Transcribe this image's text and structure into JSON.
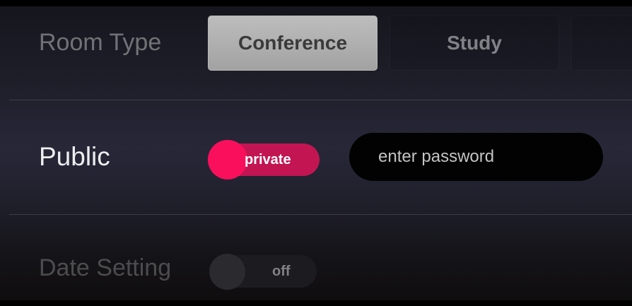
{
  "room_type": {
    "label": "Room Type",
    "options": [
      "Conference",
      "Study",
      ""
    ],
    "selected": "Conference"
  },
  "public": {
    "label": "Public",
    "toggle_text": "private",
    "toggle_state": "on",
    "password_placeholder": "enter password",
    "password_value": ""
  },
  "date_setting": {
    "label": "Date Setting",
    "toggle_text": "off",
    "toggle_state": "off"
  },
  "colors": {
    "accent": "#fa0f5d",
    "toggle_track": "#c21552",
    "selected_segment": "#b0b0b0"
  }
}
